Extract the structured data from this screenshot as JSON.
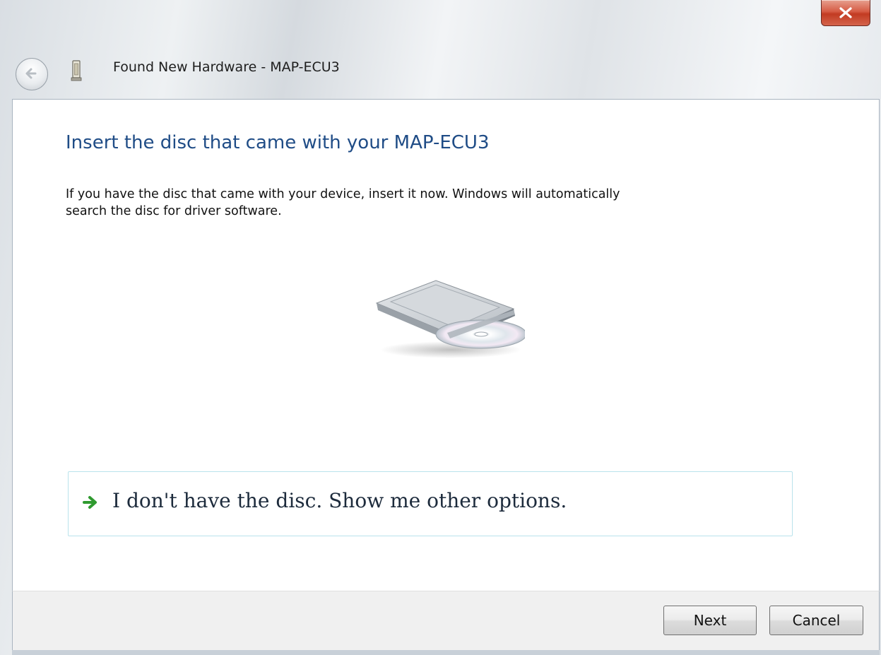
{
  "window": {
    "title": "Found New Hardware - MAP-ECU3",
    "close_icon": "close-icon",
    "back_icon": "back-arrow-icon",
    "device_icon": "usb-device-icon"
  },
  "content": {
    "main_instruction": "Insert the disc that came with your MAP-ECU3",
    "body_line1": "If you have the disc that came with your device, insert it now.  Windows will automatically",
    "body_line2": "search the disc for driver software.",
    "illustration": "optical-drive-icon",
    "option": {
      "label": "I don't have the disc.  Show me other options.",
      "icon": "green-arrow-icon"
    }
  },
  "footer": {
    "next_label": "Next",
    "cancel_label": "Cancel"
  },
  "colors": {
    "instruction": "#1f4c86",
    "option_border": "#b9e3ec",
    "arrow_green": "#2f9a2f",
    "close_red": "#c23b22"
  }
}
